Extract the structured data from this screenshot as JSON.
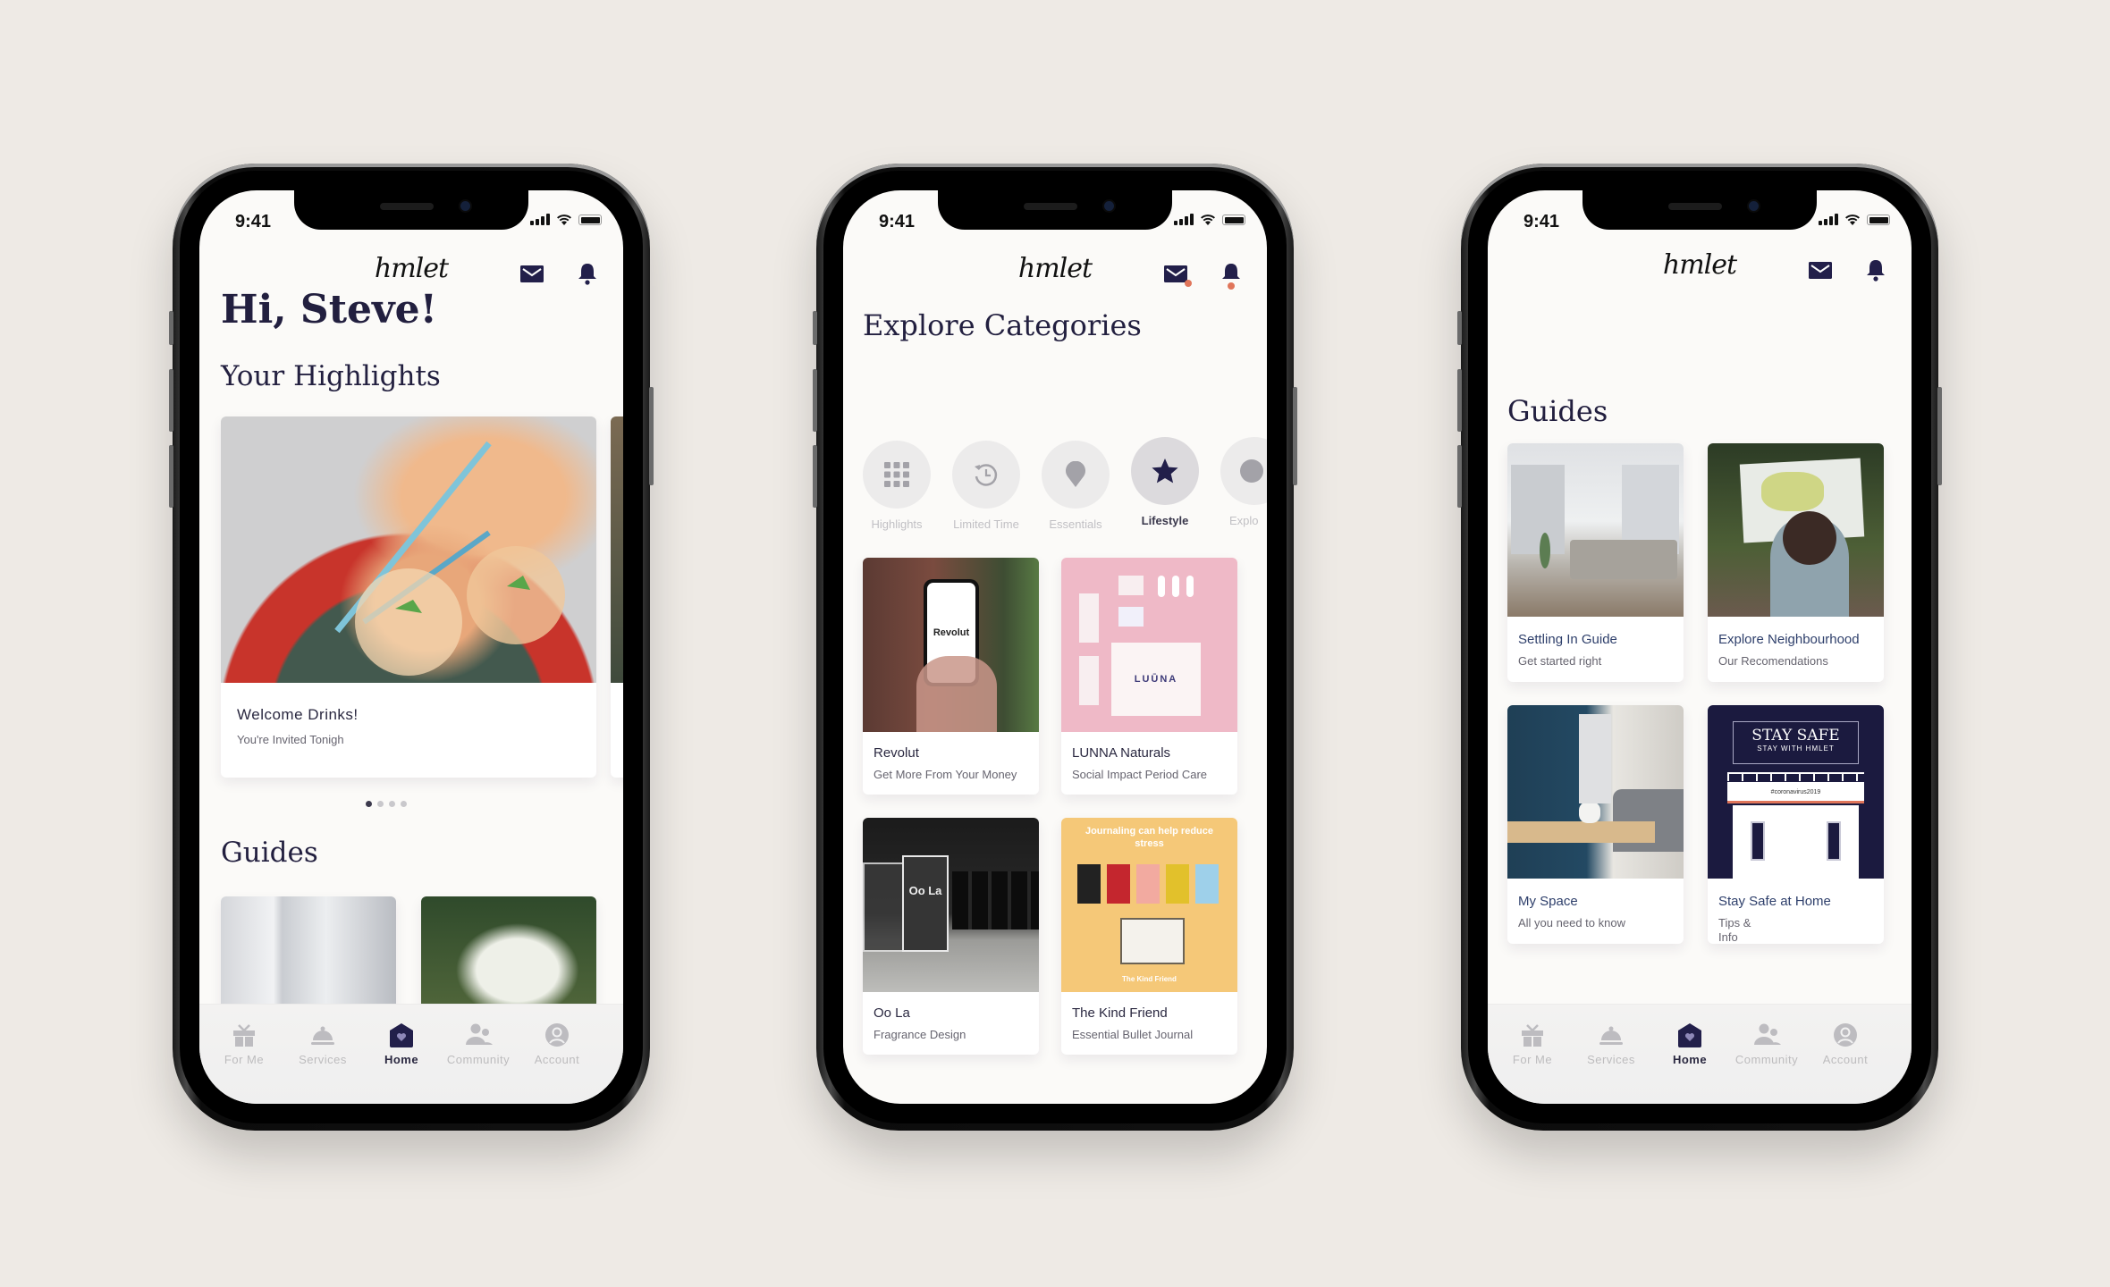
{
  "status": {
    "time": "9:41"
  },
  "brand": {
    "logo": "hmlet",
    "notification_color": "#e0755a",
    "primary": "#221f4a"
  },
  "tabbar": {
    "items": [
      {
        "label": "For Me",
        "icon": "gift-icon"
      },
      {
        "label": "Services",
        "icon": "cloche-icon"
      },
      {
        "label": "Home",
        "icon": "home-heart-icon",
        "active": true
      },
      {
        "label": "Community",
        "icon": "people-icon"
      },
      {
        "label": "Account",
        "icon": "user-circle-icon"
      }
    ]
  },
  "phone_home": {
    "greeting": "Hi, Steve!",
    "highlights_title": "Your Highlights",
    "highlight": {
      "title": "Welcome Drinks!",
      "subtitle": "You're Invited Tonigh"
    },
    "pager": {
      "current": 1,
      "total": 4
    },
    "guides_title": "Guides"
  },
  "phone_explore": {
    "title": "Explore Categories",
    "categories": [
      {
        "label": "Highlights",
        "icon": "grid-icon"
      },
      {
        "label": "Limited Time",
        "icon": "history-clock-icon"
      },
      {
        "label": "Essentials",
        "icon": "map-pin-icon"
      },
      {
        "label": "Lifestyle",
        "icon": "star-icon",
        "active": true
      },
      {
        "label": "Explo",
        "icon": "leaf-icon"
      }
    ],
    "items": [
      {
        "title": "Revolut",
        "subtitle": "Get More From Your Money",
        "image_text": "Revolut"
      },
      {
        "title": "LUNNA Naturals",
        "subtitle": "Social Impact Period Care",
        "image_text": "LUŪNA"
      },
      {
        "title": "Oo La",
        "subtitle": "Fragrance Design",
        "image_text": "Oo La"
      },
      {
        "title": "The Kind Friend",
        "subtitle": "Essential Bullet Journal",
        "image_text": "Journaling can help reduce stress",
        "image_footer": "The Kind Friend"
      }
    ]
  },
  "phone_guides": {
    "title": "Guides",
    "items": [
      {
        "title": "Settling In Guide",
        "subtitle": "Get started right"
      },
      {
        "title": "Explore Neighbourhood",
        "subtitle": "Our Recomendations"
      },
      {
        "title": "My Space",
        "subtitle": "All you need to know"
      },
      {
        "title": "Stay Safe at Home",
        "subtitle": "Tips &\nInfo",
        "image_title": "STAY SAFE",
        "image_subtitle": "STAY WITH HMLET",
        "image_tag": "#coronavirus2019"
      }
    ]
  }
}
